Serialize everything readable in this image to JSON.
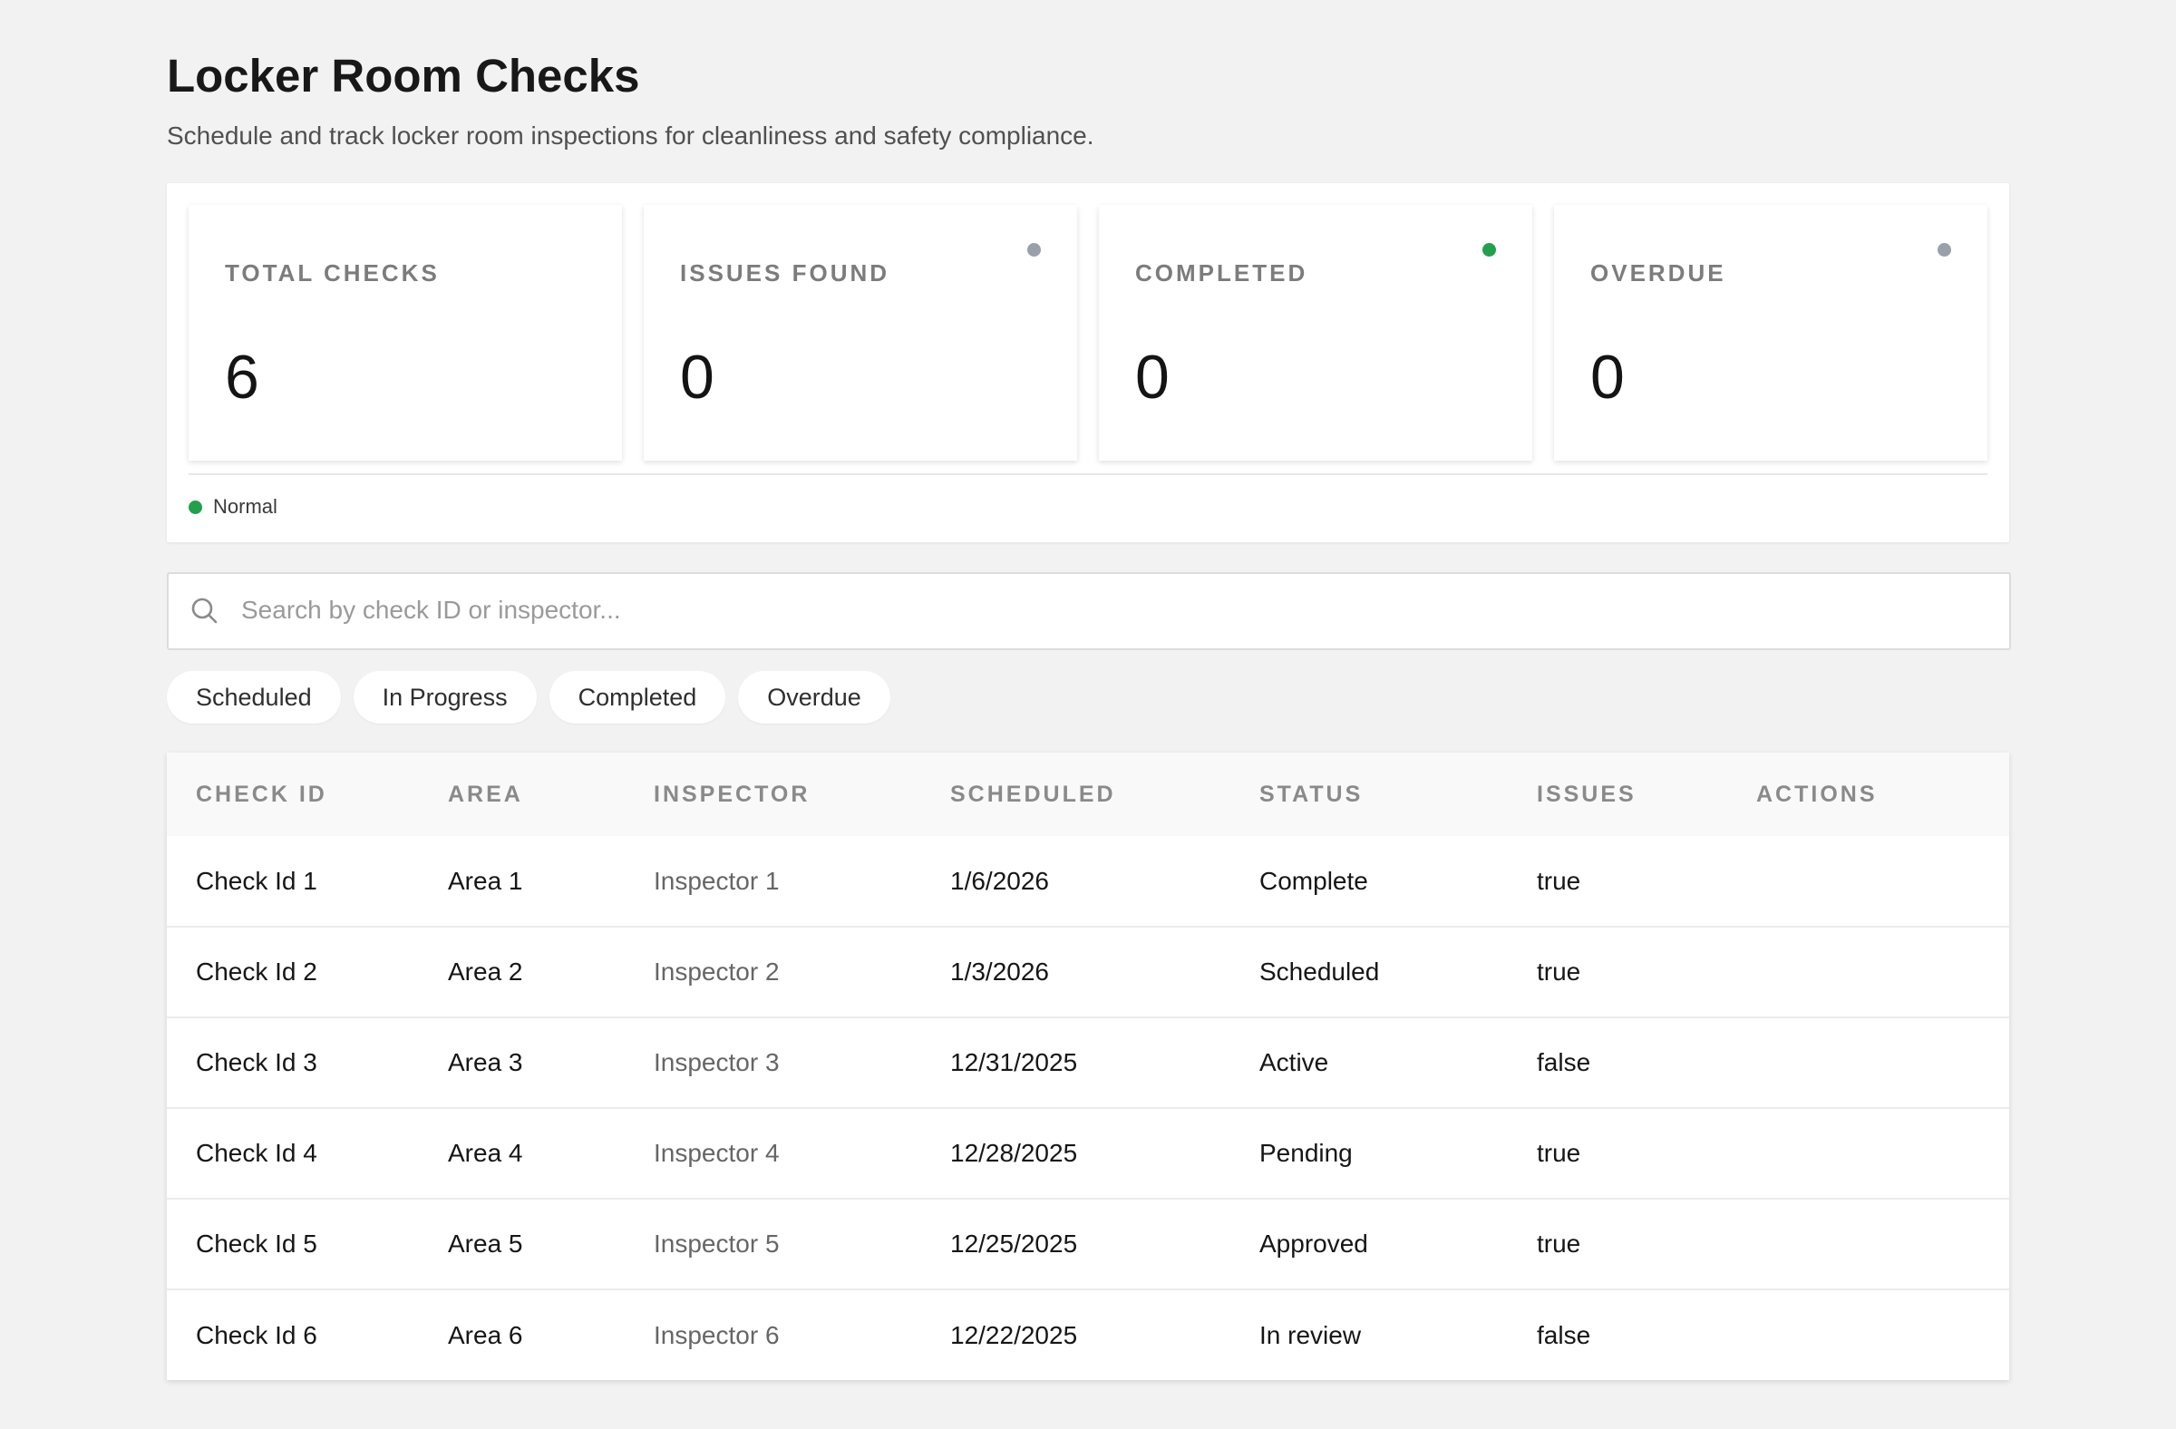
{
  "header": {
    "title": "Locker Room Checks",
    "subtitle": "Schedule and track locker room inspections for cleanliness and safety compliance."
  },
  "stats": [
    {
      "label": "TOTAL CHECKS",
      "value": "6",
      "indicator": null
    },
    {
      "label": "ISSUES FOUND",
      "value": "0",
      "indicator": "#9aa0aa"
    },
    {
      "label": "COMPLETED",
      "value": "0",
      "indicator": "#22a04b"
    },
    {
      "label": "OVERDUE",
      "value": "0",
      "indicator": "#9aa0aa"
    }
  ],
  "legend": {
    "label": "Normal",
    "color": "#22a04b"
  },
  "search": {
    "placeholder": "Search by check ID or inspector...",
    "value": "",
    "icon": "search-icon"
  },
  "filters": [
    "Scheduled",
    "In Progress",
    "Completed",
    "Overdue"
  ],
  "table": {
    "columns": [
      "CHECK ID",
      "AREA",
      "INSPECTOR",
      "SCHEDULED",
      "STATUS",
      "ISSUES",
      "ACTIONS"
    ],
    "rows": [
      {
        "check_id": "Check Id 1",
        "area": "Area 1",
        "inspector": "Inspector 1",
        "scheduled": "1/6/2026",
        "status": "Complete",
        "issues": "true",
        "actions": ""
      },
      {
        "check_id": "Check Id 2",
        "area": "Area 2",
        "inspector": "Inspector 2",
        "scheduled": "1/3/2026",
        "status": "Scheduled",
        "issues": "true",
        "actions": ""
      },
      {
        "check_id": "Check Id 3",
        "area": "Area 3",
        "inspector": "Inspector 3",
        "scheduled": "12/31/2025",
        "status": "Active",
        "issues": "false",
        "actions": ""
      },
      {
        "check_id": "Check Id 4",
        "area": "Area 4",
        "inspector": "Inspector 4",
        "scheduled": "12/28/2025",
        "status": "Pending",
        "issues": "true",
        "actions": ""
      },
      {
        "check_id": "Check Id 5",
        "area": "Area 5",
        "inspector": "Inspector 5",
        "scheduled": "12/25/2025",
        "status": "Approved",
        "issues": "true",
        "actions": ""
      },
      {
        "check_id": "Check Id 6",
        "area": "Area 6",
        "inspector": "Inspector 6",
        "scheduled": "12/22/2025",
        "status": "In review",
        "issues": "false",
        "actions": ""
      }
    ]
  }
}
